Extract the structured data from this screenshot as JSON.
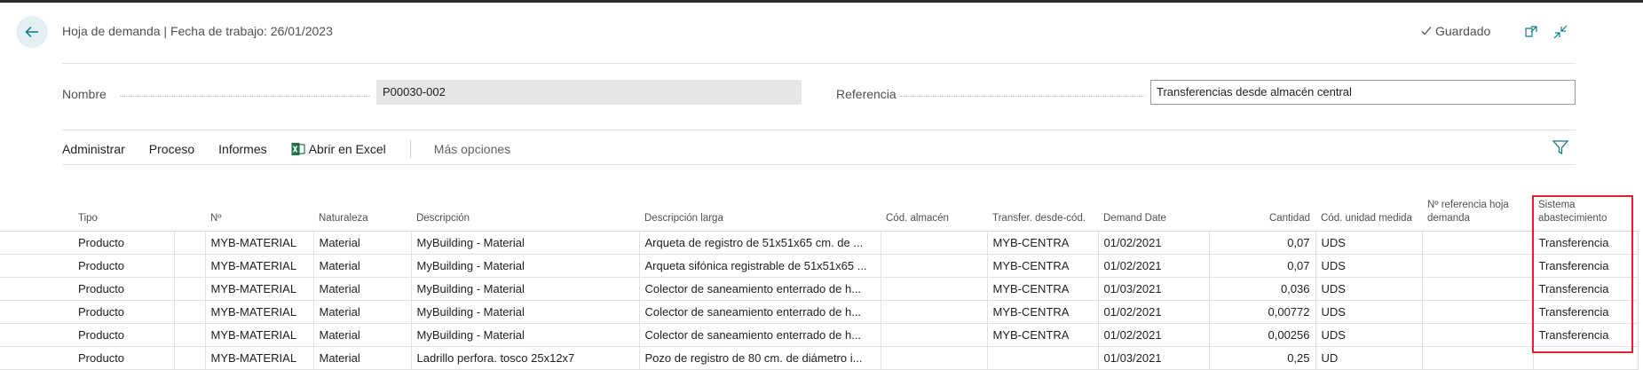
{
  "header": {
    "title": "Hoja de demanda | Fecha de trabajo: 26/01/2023",
    "saved_label": "Guardado"
  },
  "form": {
    "name_label": "Nombre",
    "name_value": "P00030-002",
    "reference_label": "Referencia",
    "reference_value": "Transferencias desde almacén central"
  },
  "actions": {
    "administrar": "Administrar",
    "proceso": "Proceso",
    "informes": "Informes",
    "excel": "Abrir en Excel",
    "more": "Más opciones"
  },
  "columns": {
    "tipo": "Tipo",
    "no": "Nº",
    "naturaleza": "Naturaleza",
    "descripcion": "Descripción",
    "descripcion_larga": "Descripción larga",
    "cod_almacen": "Cód. almacén",
    "transfer": "Transfer. desde-cód.",
    "demand_date": "Demand Date",
    "cantidad": "Cantidad",
    "cod_unidad": "Cód. unidad medida",
    "ref_hoja": "Nº referencia hoja demanda",
    "sistema": "Sistema abastecimiento"
  },
  "rows": [
    {
      "tipo": "Producto",
      "no": "MYB-MATERIAL",
      "naturaleza": "Material",
      "descripcion": "MyBuilding - Material",
      "descripcion_larga": "Arqueta de registro de 51x51x65 cm. de ...",
      "cod_almacen": "",
      "transfer": "MYB-CENTRA",
      "demand_date": "01/02/2021",
      "cantidad": "0,07",
      "cod_unidad": "UDS",
      "ref_hoja": "",
      "sistema": "Transferencia"
    },
    {
      "tipo": "Producto",
      "no": "MYB-MATERIAL",
      "naturaleza": "Material",
      "descripcion": "MyBuilding - Material",
      "descripcion_larga": "Arqueta sifónica registrable de 51x51x65 ...",
      "cod_almacen": "",
      "transfer": "MYB-CENTRA",
      "demand_date": "01/02/2021",
      "cantidad": "0,07",
      "cod_unidad": "UDS",
      "ref_hoja": "",
      "sistema": "Transferencia"
    },
    {
      "tipo": "Producto",
      "no": "MYB-MATERIAL",
      "naturaleza": "Material",
      "descripcion": "MyBuilding - Material",
      "descripcion_larga": "Colector de saneamiento enterrado de h...",
      "cod_almacen": "",
      "transfer": "MYB-CENTRA",
      "demand_date": "01/03/2021",
      "cantidad": "0,036",
      "cod_unidad": "UDS",
      "ref_hoja": "",
      "sistema": "Transferencia"
    },
    {
      "tipo": "Producto",
      "no": "MYB-MATERIAL",
      "naturaleza": "Material",
      "descripcion": "MyBuilding - Material",
      "descripcion_larga": "Colector de saneamiento enterrado de h...",
      "cod_almacen": "",
      "transfer": "MYB-CENTRA",
      "demand_date": "01/02/2021",
      "cantidad": "0,00772",
      "cod_unidad": "UDS",
      "ref_hoja": "",
      "sistema": "Transferencia"
    },
    {
      "tipo": "Producto",
      "no": "MYB-MATERIAL",
      "naturaleza": "Material",
      "descripcion": "MyBuilding - Material",
      "descripcion_larga": "Colector de saneamiento enterrado de h...",
      "cod_almacen": "",
      "transfer": "MYB-CENTRA",
      "demand_date": "01/02/2021",
      "cantidad": "0,00256",
      "cod_unidad": "UDS",
      "ref_hoja": "",
      "sistema": "Transferencia"
    },
    {
      "tipo": "Producto",
      "no": "MYB-MATERIAL",
      "naturaleza": "Material",
      "descripcion": "Ladrillo perfora. tosco 25x12x7",
      "descripcion_larga": "Pozo de registro de 80 cm. de diámetro i...",
      "cod_almacen": "",
      "transfer": "",
      "demand_date": "01/03/2021",
      "cantidad": "0,25",
      "cod_unidad": "UD",
      "ref_hoja": "",
      "sistema": ""
    }
  ],
  "colors": {
    "accent": "#0e7a8c",
    "highlight": "#e8202a",
    "excel_green": "#1e7145"
  }
}
